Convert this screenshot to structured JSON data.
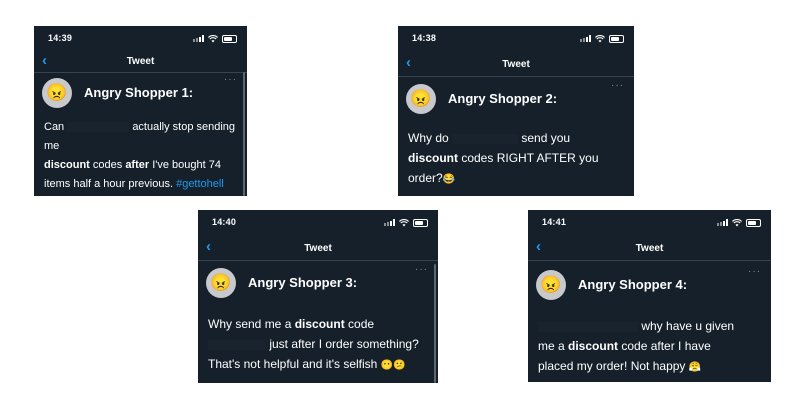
{
  "cards": [
    {
      "time": "14:39",
      "nav_title": "Tweet",
      "user": "Angry Shopper 1:",
      "avatar_emoji": "😠",
      "more": "···",
      "text": {
        "l1a": "Can",
        "l1b": "actually stop sending me",
        "l2a": "discount",
        "l2b": " codes ",
        "l2c": "after",
        "l2d": " I've bought 74",
        "l3a": "items half a hour previous. ",
        "l3b": "#gettohell",
        "l4": "🆘"
      }
    },
    {
      "time": "14:38",
      "nav_title": "Tweet",
      "user": "Angry Shopper 2:",
      "avatar_emoji": "😠",
      "more": "···",
      "text": {
        "l1a": "Why do",
        "l1b": "send you",
        "l2a": "discount",
        "l2b": " codes RIGHT AFTER you",
        "l3a": "order?",
        "l3b": "😂"
      }
    },
    {
      "time": "14:40",
      "nav_title": "Tweet",
      "user": "Angry Shopper 3:",
      "avatar_emoji": "😠",
      "more": "···",
      "text": {
        "l1a": "Why send me a ",
        "l1b": "discount",
        "l1c": " code",
        "l2": "just after I order something?",
        "l3a": "That's not helpful and it's selfish ",
        "l3b": "😶😕"
      }
    },
    {
      "time": "14:41",
      "nav_title": "Tweet",
      "user": "Angry Shopper 4:",
      "avatar_emoji": "😠",
      "more": "···",
      "text": {
        "l1": "why have u given",
        "l2a": "me a ",
        "l2b": "discount",
        "l2c": " code after I have",
        "l3a": "placed my order! Not happy ",
        "l3b": "😤"
      }
    }
  ],
  "colors": {
    "background": "#15202b",
    "accent": "#1d9bf0",
    "divider": "#38444d"
  }
}
